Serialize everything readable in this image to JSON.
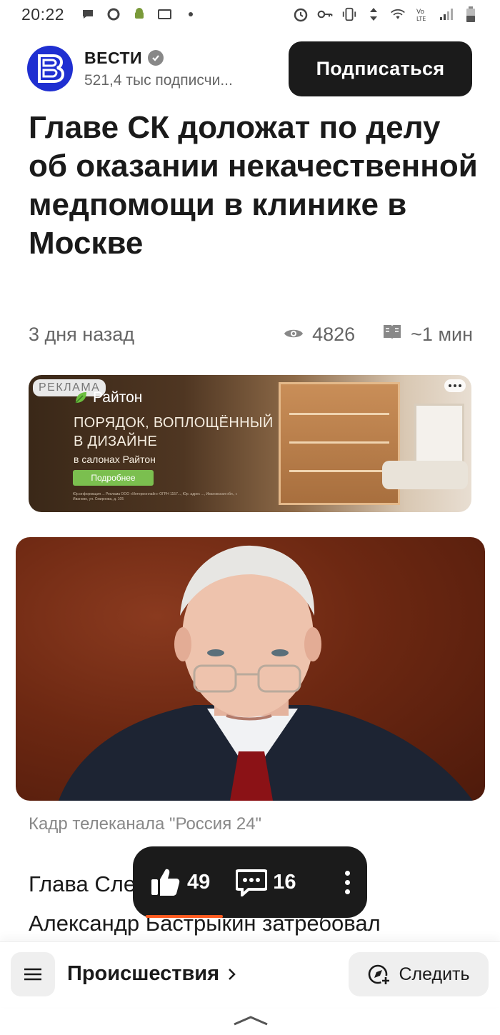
{
  "status_bar": {
    "time": "20:22",
    "icons_left": [
      "chat-icon",
      "message-icon",
      "android-icon",
      "cast-icon",
      "dot-icon"
    ],
    "icons_right": [
      "alarm-icon",
      "key-icon",
      "vibrate-icon",
      "data-arrows-icon",
      "wifi-icon",
      "volte-icon",
      "signal-icon",
      "battery-icon"
    ]
  },
  "channel": {
    "name": "ВЕСТИ",
    "subscribers": "521,4 тыс подписчи...",
    "subscribe_label": "Подписаться",
    "brand_color": "#1f2fd1"
  },
  "article": {
    "title": "Главе СК доложат по делу об оказании некачественной медпомощи в клинике в Москве",
    "date": "3 дня назад",
    "views": "4826",
    "read_time": "~1 мин",
    "photo_caption": "Кадр телеканала \"Россия 24\"",
    "body_line1": "Глава Сле                                  та",
    "body_line2": "Александр Бастрыкин затребовал"
  },
  "ad": {
    "badge": "РЕКЛАМА",
    "brand": "Райтон",
    "headline_line1": "ПОРЯДОК, ВОПЛОЩЁННЫЙ",
    "headline_line2": "В ДИЗАЙНЕ",
    "sub": "в салонах Райтон",
    "button": "Подробнее",
    "legal": "Юр.информация ... Реклама ООО «Интерионлайн» ОГРН 1157..., Юр. адрес ..., Ивановская обл., г. Иваново, ул. Смирнова, д. 105"
  },
  "reactions": {
    "likes": "49",
    "comments": "16",
    "accent_color": "#ff5a1f"
  },
  "bottom_bar": {
    "category": "Происшествия",
    "follow_label": "Следить"
  }
}
